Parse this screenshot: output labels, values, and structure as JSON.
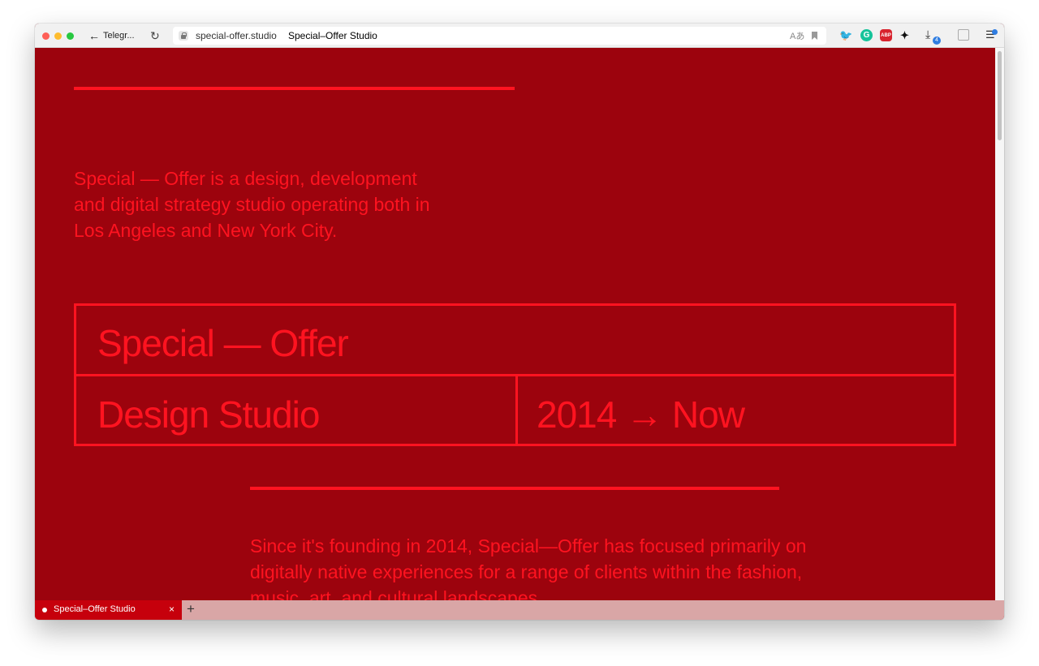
{
  "browser": {
    "back_label": "Telegr...",
    "url_domain": "special-offer.studio",
    "url_title": "Special–Offer Studio",
    "download_count": "4",
    "icons": {
      "back": "arrow-left-icon",
      "reload": "reload-icon",
      "lock": "lock-icon",
      "translate": "translate-icon",
      "bookmark": "bookmark-icon",
      "download": "download-icon",
      "menu": "menu-icon"
    }
  },
  "extensions": [
    {
      "name": "bird-extension-icon"
    },
    {
      "name": "grammarly-extension-icon",
      "label": "G",
      "color": "#15c39a"
    },
    {
      "name": "adblock-plus-extension-icon",
      "label": "ABP",
      "color": "#d8242e"
    },
    {
      "name": "tool-extension-icon"
    }
  ],
  "page": {
    "background_color": "#9c030d",
    "accent_color": "#ff1320",
    "intro": "Special — Offer is a design, development and digital strategy studio operating both in Los Angeles and New York City.",
    "brand": "Special — Offer",
    "studio": "Design Studio",
    "years": "2014 → Now",
    "since": "Since it's founding in 2014, Special—Offer has focused primarily on digitally native experiences for a range of clients within the fashion, music, art, and cultural landscapes."
  },
  "tabs": [
    {
      "title": "Special–Offer Studio",
      "active": true
    }
  ]
}
